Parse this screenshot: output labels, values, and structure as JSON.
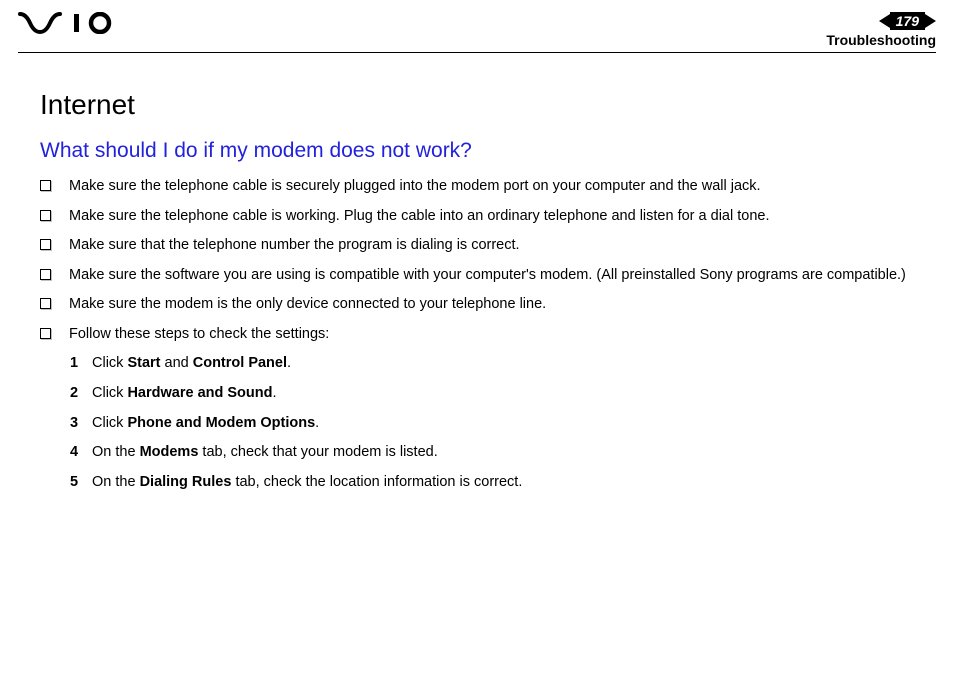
{
  "header": {
    "page_number": "179",
    "section": "Troubleshooting"
  },
  "content": {
    "title": "Internet",
    "subtitle": "What should I do if my modem does not work?",
    "bullets": [
      "Make sure the telephone cable is securely plugged into the modem port on your computer and the wall jack.",
      "Make sure the telephone cable is working. Plug the cable into an ordinary telephone and listen for a dial tone.",
      "Make sure that the telephone number the program is dialing is correct.",
      "Make sure the software you are using is compatible with your computer's modem. (All preinstalled Sony programs are compatible.)",
      "Make sure the modem is the only device connected to your telephone line.",
      "Follow these steps to check the settings:"
    ],
    "steps": [
      {
        "n": "1",
        "pre": "Click ",
        "b1": "Start",
        "mid": " and ",
        "b2": "Control Panel",
        "post": "."
      },
      {
        "n": "2",
        "pre": "Click ",
        "b1": "Hardware and Sound",
        "mid": "",
        "b2": "",
        "post": "."
      },
      {
        "n": "3",
        "pre": "Click ",
        "b1": "Phone and Modem Options",
        "mid": "",
        "b2": "",
        "post": "."
      },
      {
        "n": "4",
        "pre": "On the ",
        "b1": "Modems",
        "mid": " tab, check that your modem is listed.",
        "b2": "",
        "post": ""
      },
      {
        "n": "5",
        "pre": "On the ",
        "b1": "Dialing Rules",
        "mid": " tab, check the location information is correct.",
        "b2": "",
        "post": ""
      }
    ]
  }
}
